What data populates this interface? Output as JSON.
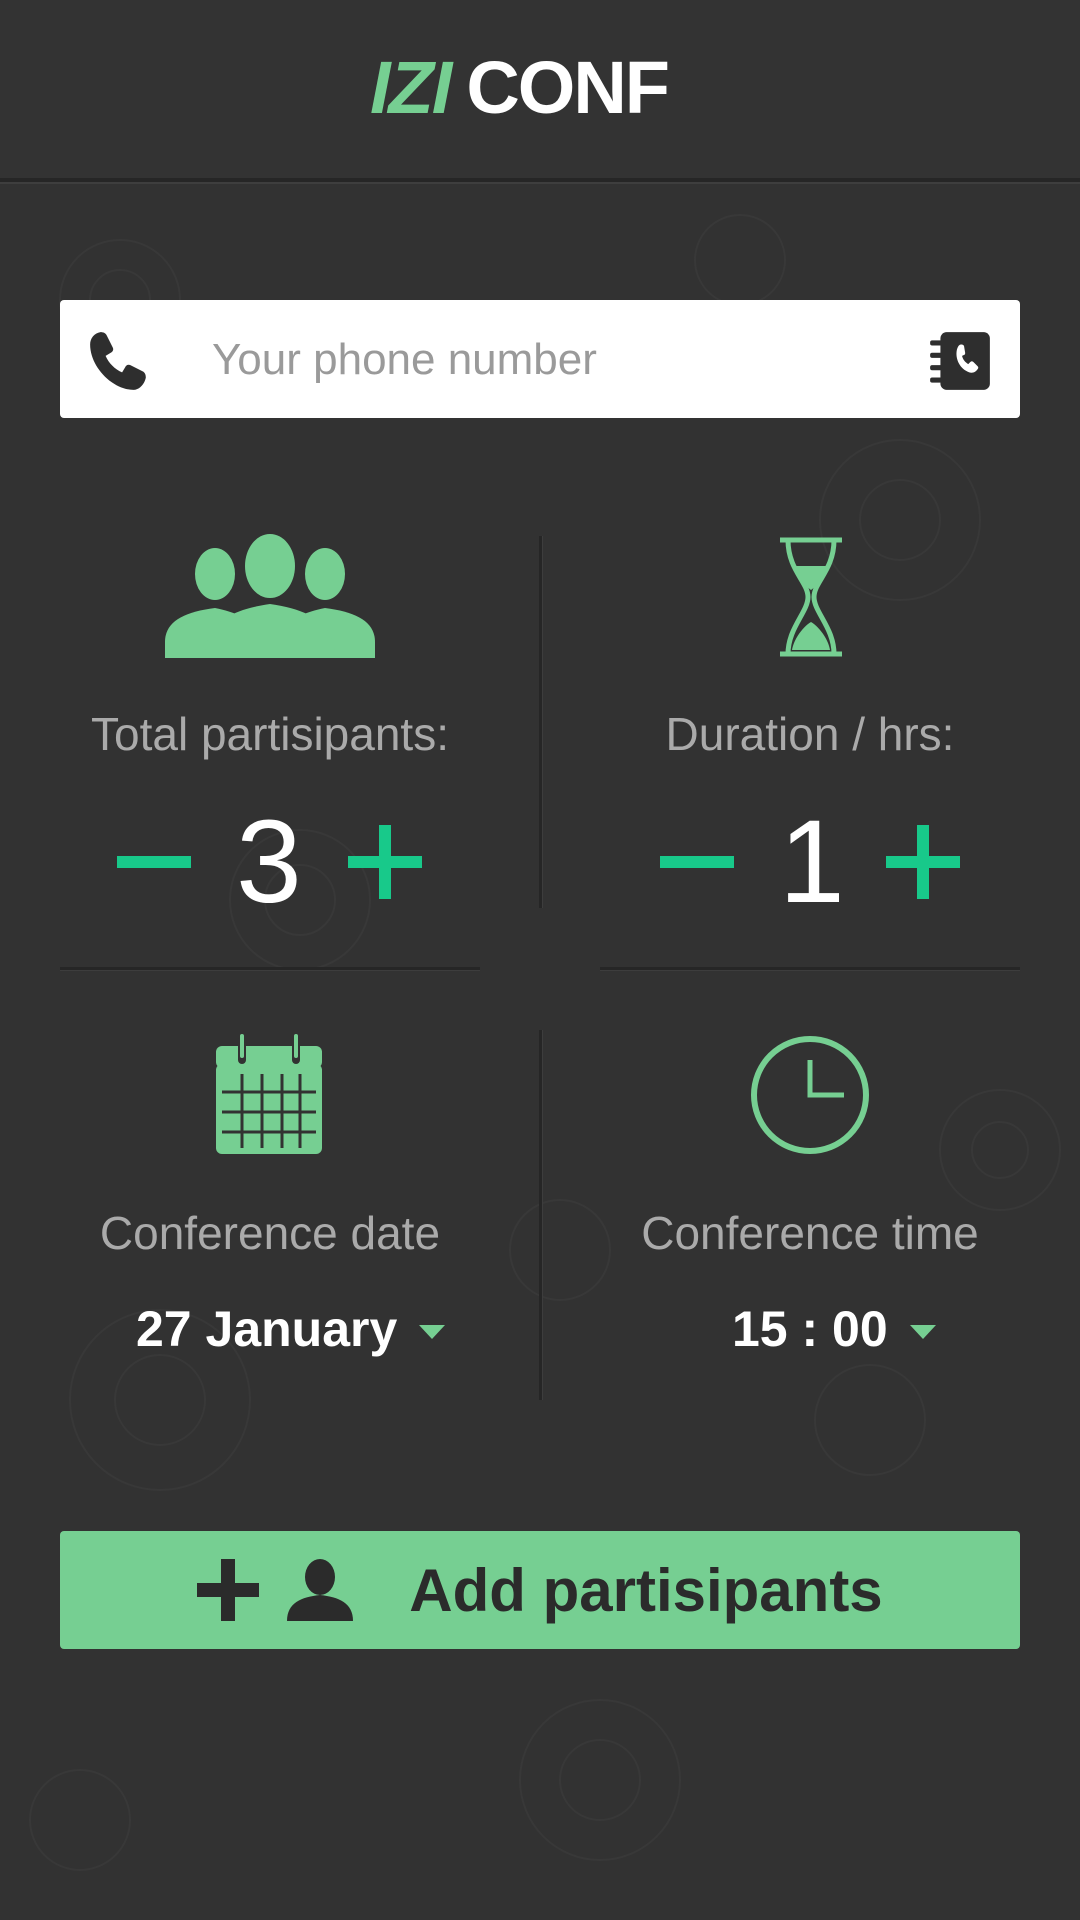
{
  "app": {
    "logo_izi": "IZI",
    "logo_conf": "CONF"
  },
  "phone": {
    "placeholder": "Your phone number",
    "value": "",
    "left_icon": "phone-icon",
    "right_icon": "contacts-book-icon"
  },
  "participants": {
    "icon": "group-icon",
    "label": "Total partisipants:",
    "value": "3",
    "decrement": "−",
    "increment": "+"
  },
  "duration": {
    "icon": "hourglass-icon",
    "label": "Duration / hrs:",
    "value": "1",
    "decrement": "−",
    "increment": "+"
  },
  "date": {
    "icon": "calendar-icon",
    "label": "Conference date",
    "value": "27 January"
  },
  "time": {
    "icon": "clock-icon",
    "label": "Conference time",
    "value": "15 : 00"
  },
  "add_button": {
    "label": "Add partisipants",
    "icons": [
      "plus-icon",
      "person-icon"
    ]
  },
  "colors": {
    "background": "#323232",
    "accent": "#76cf92",
    "stepper_accent": "#18c98a",
    "text_muted": "#aaaaaa",
    "text_primary": "#ffffff"
  }
}
